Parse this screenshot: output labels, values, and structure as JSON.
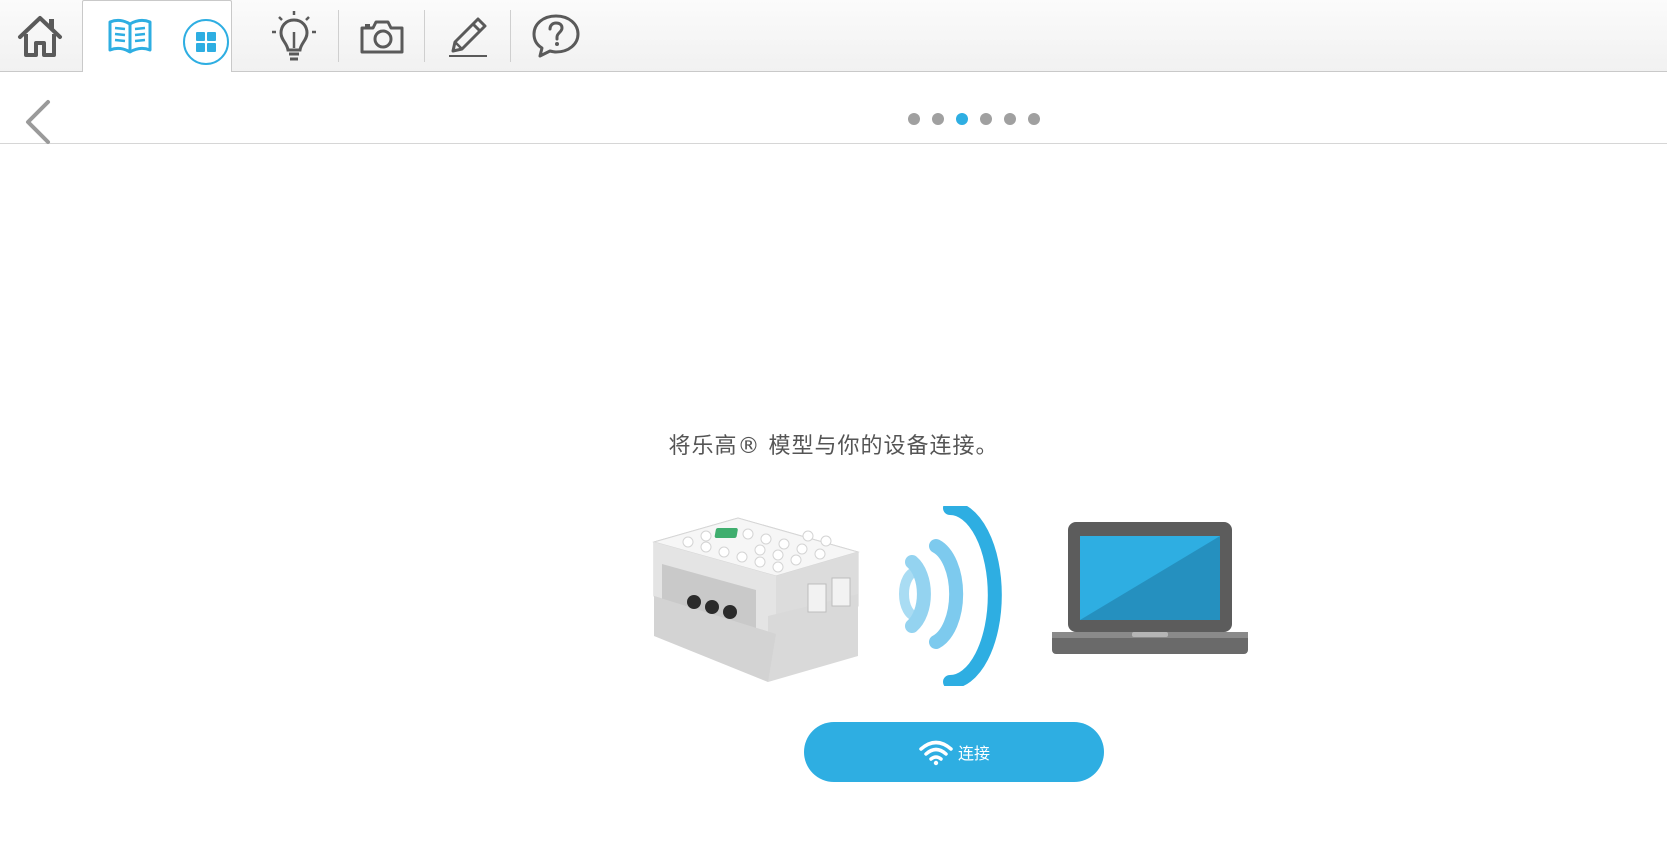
{
  "toolbar": {
    "items": [
      {
        "icon": "home-icon"
      },
      {
        "icon": "book-icon"
      },
      {
        "icon": "grid-icon"
      },
      {
        "icon": "lightbulb-icon"
      },
      {
        "icon": "camera-icon"
      },
      {
        "icon": "pencil-icon"
      },
      {
        "icon": "help-icon"
      }
    ]
  },
  "pager": {
    "total": 6,
    "current": 3
  },
  "main": {
    "instruction": "将乐高® 模型与你的设备连接。",
    "connect_label": "连接"
  },
  "colors": {
    "accent": "#2eaee2",
    "icon_gray": "#5a5a5a",
    "dot_inactive": "#a0a0a0"
  }
}
